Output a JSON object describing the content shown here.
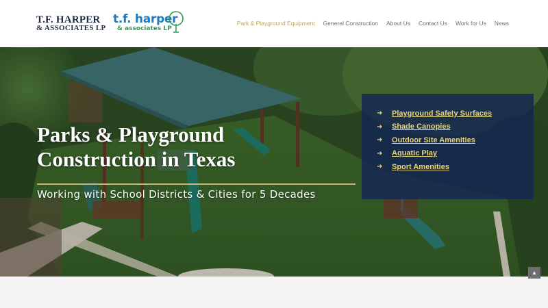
{
  "header": {
    "logo_primary_line1": "T.F. HARPER",
    "logo_primary_line2": "& ASSOCIATES LP",
    "logo_secondary_line1": "t.f. harper",
    "logo_secondary_line2": "& associates LP",
    "nav": [
      {
        "label": "Park & Playground Equipment",
        "active": true
      },
      {
        "label": "General Construction",
        "active": false
      },
      {
        "label": "About Us",
        "active": false
      },
      {
        "label": "Contact Us",
        "active": false
      },
      {
        "label": "Work for Us",
        "active": false
      },
      {
        "label": "News",
        "active": false
      }
    ]
  },
  "hero": {
    "title": "Parks & Playground Construction in Texas",
    "subtitle": "Working with School Districts & Cities for 5 Decades",
    "links": [
      {
        "label": "Playground Safety Surfaces",
        "icon": "arrow-right-icon"
      },
      {
        "label": "Shade Canopies",
        "icon": "arrow-right-icon"
      },
      {
        "label": "Outdoor Site Amenities",
        "icon": "arrow-right-icon"
      },
      {
        "label": "Aquatic Play",
        "icon": "arrow-right-icon"
      },
      {
        "label": "Sport Amenities",
        "icon": "arrow-right-icon"
      }
    ],
    "arrow_glyph": "➜"
  },
  "scroll_top_glyph": "▲",
  "colors": {
    "accent_gold": "#b8a55a",
    "link_yellow": "#e8d47a",
    "panel_navy": "#142850",
    "logo_navy": "#1b2a44",
    "logo_blue": "#1e7bbf",
    "logo_green": "#2f9e55"
  }
}
